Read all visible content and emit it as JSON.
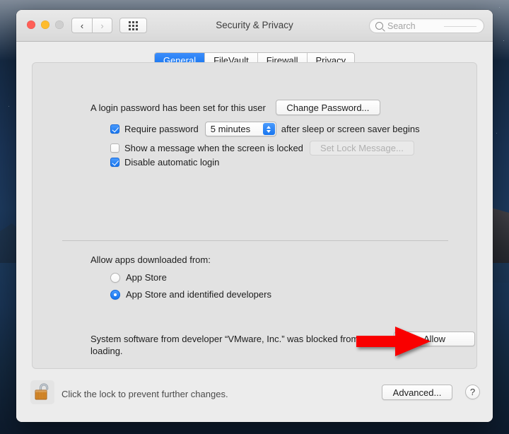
{
  "window": {
    "title": "Security & Privacy",
    "traffic_lights": [
      "close",
      "minimize",
      "zoom"
    ],
    "nav_back": "‹",
    "nav_forward": "›",
    "grid_icon": "grid-icon",
    "search": {
      "placeholder": "Search",
      "icon": "search-icon"
    }
  },
  "tabs": [
    {
      "label": "General",
      "active": true
    },
    {
      "label": "FileVault",
      "active": false
    },
    {
      "label": "Firewall",
      "active": false
    },
    {
      "label": "Privacy",
      "active": false
    }
  ],
  "general": {
    "password_status": "A login password has been set for this user",
    "change_password_label": "Change Password...",
    "require_password": {
      "label": "Require password",
      "checked": true,
      "delay_value": "5 minutes",
      "suffix": "after sleep or screen saver begins"
    },
    "show_message": {
      "label": "Show a message when the screen is locked",
      "checked": false,
      "button_label": "Set Lock Message...",
      "button_disabled": true
    },
    "disable_auto_login": {
      "label": "Disable automatic login",
      "checked": true
    },
    "allow_apps_label": "Allow apps downloaded from:",
    "allow_options": [
      {
        "label": "App Store",
        "selected": false
      },
      {
        "label": "App Store and identified developers",
        "selected": true
      }
    ],
    "blocked_notice": "System software from developer “VMware, Inc.” was blocked from loading.",
    "allow_button_label": "Allow",
    "annotation": {
      "name": "red-arrow",
      "color": "#F90000",
      "points_to": "Allow"
    }
  },
  "footer": {
    "lock_icon": "open-padlock-icon",
    "lock_hint": "Click the lock to prevent further changes.",
    "advanced_label": "Advanced...",
    "help_label": "?"
  },
  "colors": {
    "accent_blue": "#1775ef",
    "window_bg": "#ececec",
    "panel_bg": "#e2e2e2",
    "annotation_red": "#F90000",
    "desktop_top": "#152a44",
    "desktop_bottom": "#0f1f36"
  }
}
